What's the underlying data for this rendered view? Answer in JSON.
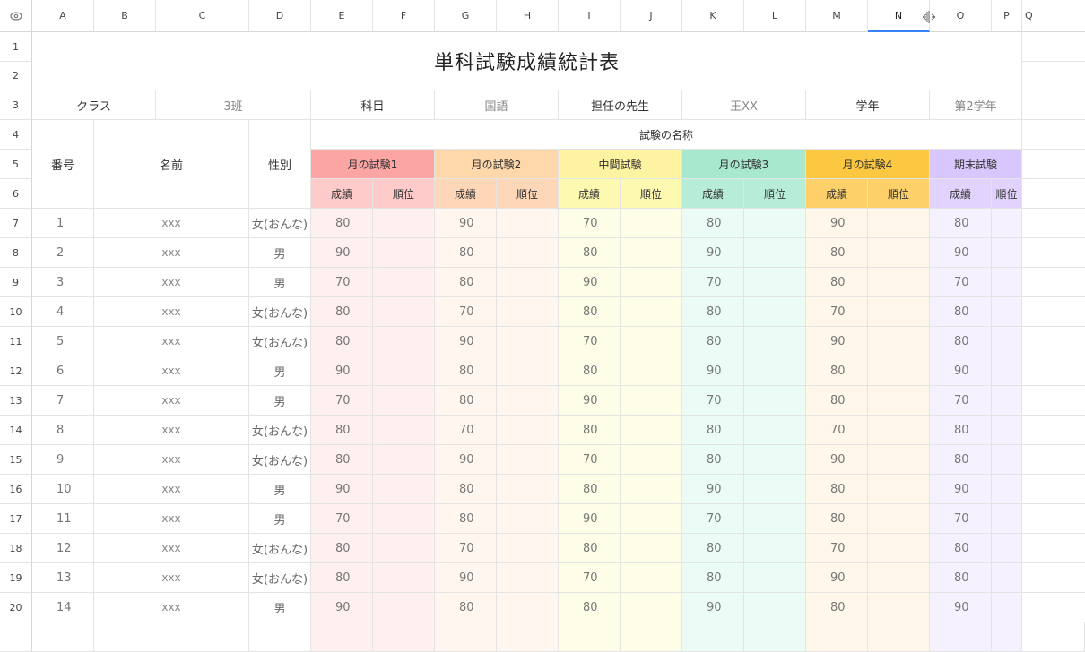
{
  "columns": [
    "A",
    "B",
    "C",
    "D",
    "E",
    "F",
    "G",
    "H",
    "I",
    "J",
    "K",
    "L",
    "M",
    "N",
    "O",
    "P",
    "Q"
  ],
  "title": "単科試験成績統計表",
  "info": {
    "class_label": "クラス",
    "class_value": "3班",
    "subject_label": "科目",
    "subject_value": "国語",
    "teacher_label": "担任の先生",
    "teacher_value": "王XX",
    "grade_label": "学年",
    "grade_value": "第2学年"
  },
  "headers": {
    "number": "番号",
    "name": "名前",
    "gender": "性別",
    "exam_group": "試験の名称",
    "exams": [
      "月の試験1",
      "月の試験2",
      "中間試験",
      "月の試験3",
      "月の試験4",
      "期末試験"
    ],
    "score": "成績",
    "rank": "順位"
  },
  "students": [
    {
      "row": "7",
      "no": "1",
      "name": "xxx",
      "gender": "女(おんな)",
      "scores": [
        "80",
        "90",
        "70",
        "80",
        "90",
        "80"
      ]
    },
    {
      "row": "8",
      "no": "2",
      "name": "xxx",
      "gender": "男",
      "scores": [
        "90",
        "80",
        "80",
        "90",
        "80",
        "90"
      ]
    },
    {
      "row": "9",
      "no": "3",
      "name": "xxx",
      "gender": "男",
      "scores": [
        "70",
        "80",
        "90",
        "70",
        "80",
        "70"
      ]
    },
    {
      "row": "10",
      "no": "4",
      "name": "xxx",
      "gender": "女(おんな)",
      "scores": [
        "80",
        "70",
        "80",
        "80",
        "70",
        "80"
      ]
    },
    {
      "row": "11",
      "no": "5",
      "name": "xxx",
      "gender": "女(おんな)",
      "scores": [
        "80",
        "90",
        "70",
        "80",
        "90",
        "80"
      ]
    },
    {
      "row": "12",
      "no": "6",
      "name": "xxx",
      "gender": "男",
      "scores": [
        "90",
        "80",
        "80",
        "90",
        "80",
        "90"
      ]
    },
    {
      "row": "13",
      "no": "7",
      "name": "xxx",
      "gender": "男",
      "scores": [
        "70",
        "80",
        "90",
        "70",
        "80",
        "70"
      ]
    },
    {
      "row": "14",
      "no": "8",
      "name": "xxx",
      "gender": "女(おんな)",
      "scores": [
        "80",
        "70",
        "80",
        "80",
        "70",
        "80"
      ]
    },
    {
      "row": "15",
      "no": "9",
      "name": "xxx",
      "gender": "女(おんな)",
      "scores": [
        "80",
        "90",
        "70",
        "80",
        "90",
        "80"
      ]
    },
    {
      "row": "16",
      "no": "10",
      "name": "xxx",
      "gender": "男",
      "scores": [
        "90",
        "80",
        "80",
        "90",
        "80",
        "90"
      ]
    },
    {
      "row": "17",
      "no": "11",
      "name": "xxx",
      "gender": "男",
      "scores": [
        "70",
        "80",
        "90",
        "70",
        "80",
        "70"
      ]
    },
    {
      "row": "18",
      "no": "12",
      "name": "xxx",
      "gender": "女(おんな)",
      "scores": [
        "80",
        "70",
        "80",
        "80",
        "70",
        "80"
      ]
    },
    {
      "row": "19",
      "no": "13",
      "name": "xxx",
      "gender": "女(おんな)",
      "scores": [
        "80",
        "90",
        "70",
        "80",
        "90",
        "80"
      ]
    },
    {
      "row": "20",
      "no": "14",
      "name": "xxx",
      "gender": "男",
      "scores": [
        "90",
        "80",
        "80",
        "90",
        "80",
        "90"
      ]
    }
  ],
  "icons": {
    "visibility": "eye-icon",
    "column_resize": "column-resize-icon"
  },
  "colors": {
    "exam1": "#fca5a5",
    "exam2": "#fed7aa",
    "exam3": "#fef3a0",
    "exam4": "#a7e8cf",
    "exam5": "#fcc842",
    "exam6": "#d8c7fc",
    "selected": "#3b82f6"
  }
}
